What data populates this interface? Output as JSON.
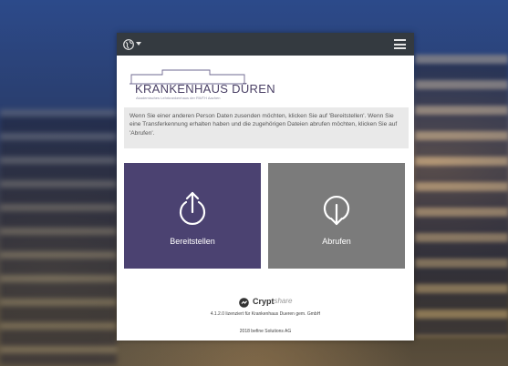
{
  "header": {
    "language_icon": "globe-icon",
    "menu_icon": "hamburger-menu-icon"
  },
  "logo": {
    "title": "KRANKENHAUS DÜREN",
    "subtitle": "Akademisches Lehrkrankenhaus der RWTH Aachen"
  },
  "notice": {
    "text": "Wenn Sie einer anderen Person Daten zusenden möchten, klicken Sie auf 'Bereitstellen'. Wenn Sie eine Transferkennung erhalten haben und die zugehörigen Dateien abrufen möchten, klicken Sie auf 'Abrufen'."
  },
  "actions": {
    "upload": {
      "label": "Bereitstellen",
      "icon": "upload-icon",
      "color": "#4b4271"
    },
    "download": {
      "label": "Abrufen",
      "icon": "download-icon",
      "color": "#7b7b7b"
    }
  },
  "footer": {
    "brand_name": "Crypt",
    "brand_suffix": "share",
    "license": "4.1.2.0 lizenziert für Krankenhaus Dueren gem. GmbH",
    "copyright": "2018 befine Solutions AG"
  }
}
